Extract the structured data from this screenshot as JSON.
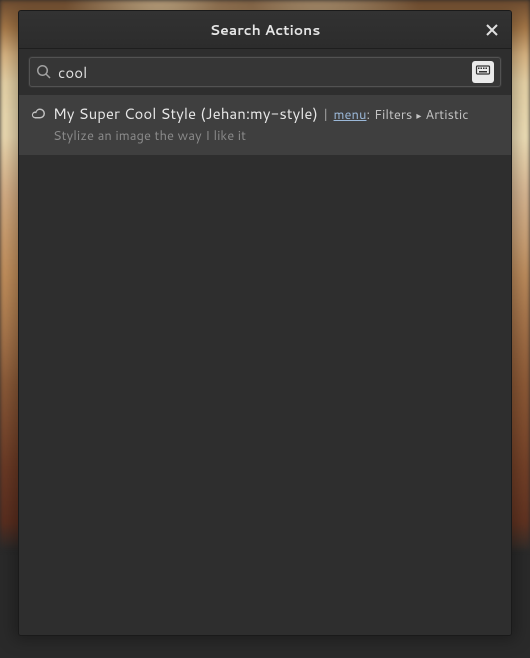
{
  "dialog": {
    "title": "Search Actions"
  },
  "search": {
    "value": "cool",
    "placeholder": ""
  },
  "results": [
    {
      "name": "My Super Cool Style (Jehan:my-style)",
      "menu_label": "menu",
      "menu_path_1": "Filters",
      "menu_path_2": "Artistic",
      "description": "Stylize an image the way I like it"
    }
  ]
}
